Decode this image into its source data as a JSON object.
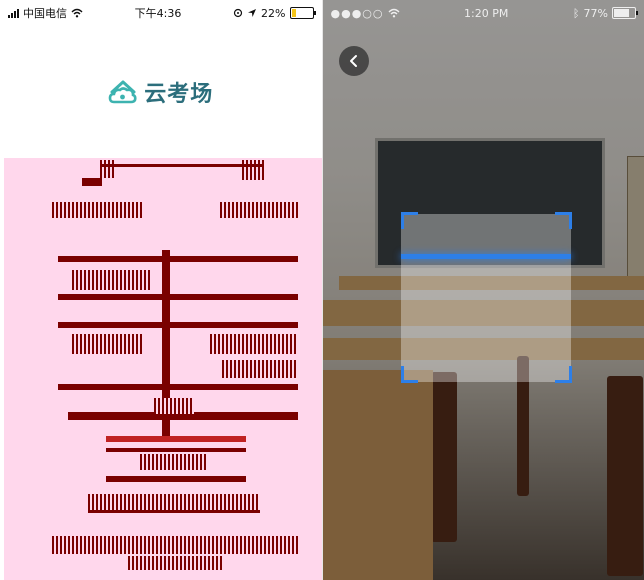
{
  "left_phone": {
    "status": {
      "carrier": "中国电信",
      "time": "下午4:36",
      "battery": "22%"
    },
    "app_name": "云考场"
  },
  "right_phone": {
    "status": {
      "time": "1:20 PM",
      "battery": "77%"
    }
  },
  "colors": {
    "scan_accent": "#2d7fe8",
    "logo_teal": "#2c6e7c",
    "glitch_bg": "#ffd7ec"
  },
  "icons": {
    "back": "chevron-left-icon",
    "logo": "cloud-home-icon"
  }
}
